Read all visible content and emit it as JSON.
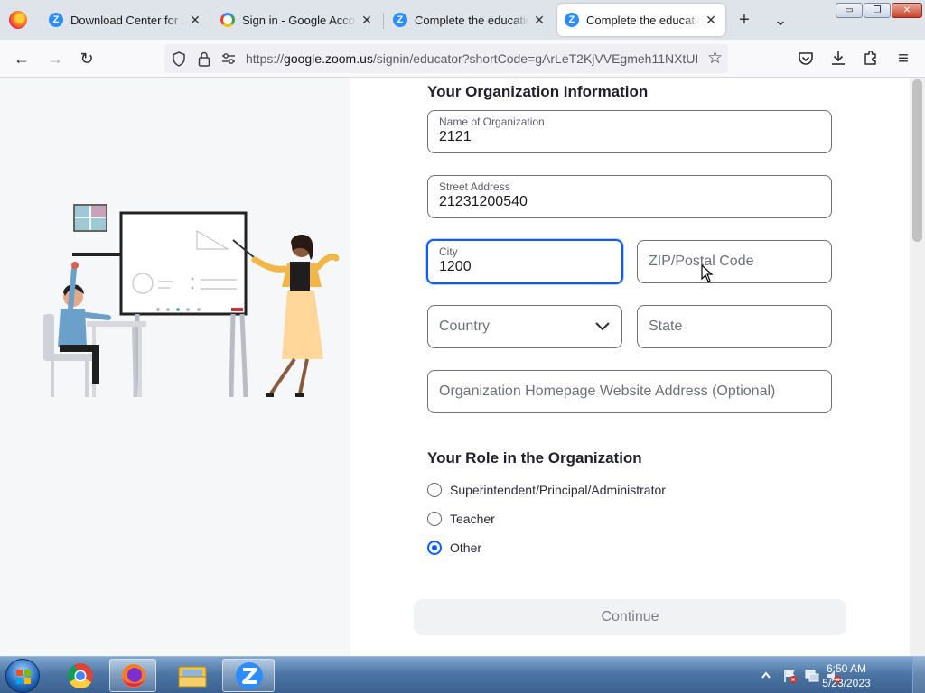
{
  "browser": {
    "tabs": [
      {
        "title": "Download Center for Zoom",
        "icon": "zoom-icon",
        "active": false
      },
      {
        "title": "Sign in - Google Accounts",
        "icon": "google-icon",
        "active": false
      },
      {
        "title": "Complete the education",
        "icon": "zoom-icon",
        "active": false
      },
      {
        "title": "Complete the education",
        "icon": "zoom-icon",
        "active": true
      }
    ],
    "close_glyph": "✕",
    "new_tab_glyph": "+",
    "list_tabs_glyph": "⌄",
    "window_controls": {
      "minimize": "▭",
      "restore": "❐",
      "close": "✕"
    }
  },
  "navbar": {
    "back_glyph": "←",
    "forward_glyph": "→",
    "reload_glyph": "↻",
    "url_prefix": "https://",
    "url_domain": "google.zoom.us",
    "url_rest": "/signin/educator?shortCode=gArLeT2KjVVEgmeh11NXtUI",
    "bookmark_glyph": "☆",
    "menu_glyph": "≡"
  },
  "form": {
    "org_section_title": "Your Organization Information",
    "org_name": {
      "label": "Name of Organization",
      "value": "2121"
    },
    "street": {
      "label": "Street Address",
      "value": "21231200540"
    },
    "city": {
      "label": "City",
      "value": "1200"
    },
    "zip": {
      "placeholder": "ZIP/Postal Code"
    },
    "country": {
      "placeholder": "Country"
    },
    "state": {
      "placeholder": "State"
    },
    "website": {
      "placeholder": "Organization Homepage Website Address (Optional)"
    },
    "role_section_title": "Your Role in the Organization",
    "roles": [
      {
        "label": "Superintendent/Principal/Administrator",
        "selected": false
      },
      {
        "label": "Teacher",
        "selected": false
      },
      {
        "label": "Other",
        "selected": true
      }
    ],
    "continue_label": "Continue"
  },
  "taskbar": {
    "apps": [
      "chrome-icon",
      "firefox-icon",
      "file-explorer-icon",
      "zoom-icon"
    ],
    "time": "6:50 AM",
    "date": "5/23/2023"
  },
  "colors": {
    "accent": "#0b5cff",
    "zoom_blue": "#2d8cff"
  }
}
